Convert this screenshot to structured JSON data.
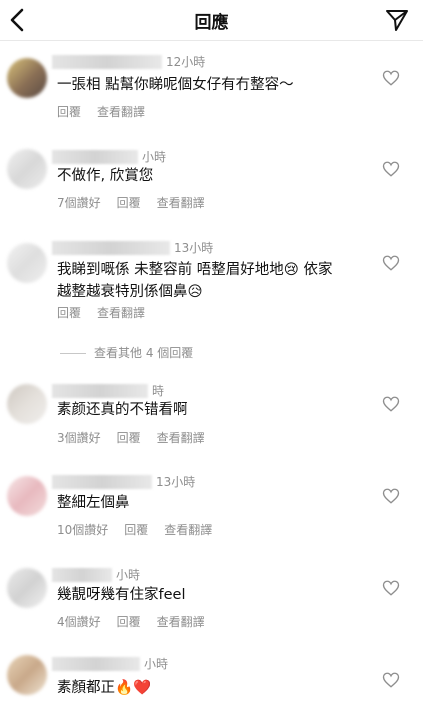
{
  "header": {
    "title": "回應"
  },
  "comments": [
    {
      "time": "12小時",
      "text": "一張相 點幫你睇呢個女仔有冇整容～",
      "likes": "",
      "reply": "回覆",
      "translate": "查看翻譯"
    },
    {
      "time": "小時",
      "text": "不做作, 欣賞您",
      "likes": "7個讚好",
      "reply": "回覆",
      "translate": "查看翻譯"
    },
    {
      "time": "13小時",
      "text_line1": "我睇到嘅係 未整容前 唔整眉好地地😢 依家",
      "text_line2": "越整越衰特別係個鼻😥",
      "likes": "",
      "reply": "回覆",
      "translate": "查看翻譯"
    },
    {
      "time": "時",
      "text": "素颜还真的不错看啊",
      "likes": "3個讚好",
      "reply": "回覆",
      "translate": "查看翻譯"
    },
    {
      "time": "13小時",
      "text": "整細左個鼻",
      "likes": "10個讚好",
      "reply": "回覆",
      "translate": "查看翻譯"
    },
    {
      "time": "小時",
      "text": "幾靚呀幾有住家feel",
      "likes": "4個讚好",
      "reply": "回覆",
      "translate": "查看翻譯"
    },
    {
      "time": "小時",
      "text": "素顏都正🔥❤️",
      "likes": "",
      "reply": "",
      "translate": ""
    }
  ],
  "view_more_replies": "查看其他 4 個回覆",
  "colors": {
    "text": "#111111",
    "secondary": "#8e8e8e",
    "background": "#ffffff"
  },
  "icons": [
    "back-icon",
    "send-icon",
    "heart-icon"
  ]
}
